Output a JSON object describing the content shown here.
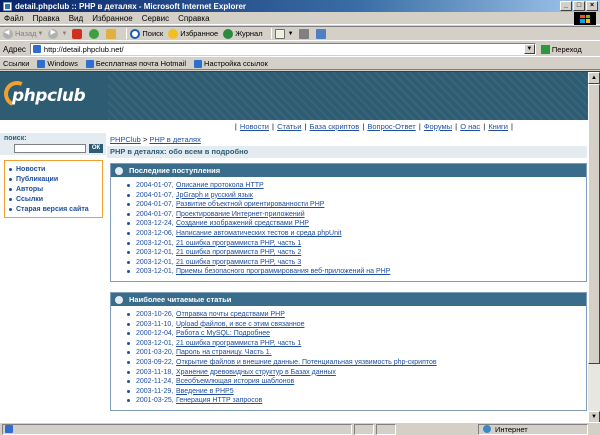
{
  "window": {
    "title": "detail.phpclub :: PHP в деталях - Microsoft Internet Explorer",
    "controls": {
      "minimize": "_",
      "maximize": "□",
      "close": "×"
    }
  },
  "menu": [
    "Файл",
    "Правка",
    "Вид",
    "Избранное",
    "Сервис",
    "Справка"
  ],
  "toolbar": {
    "back": "Назад",
    "search": "Поиск",
    "favorites": "Избранное",
    "history": "Журнал"
  },
  "address": {
    "label": "Адрес",
    "url": "http://detail.phpclub.net/",
    "go": "Переход"
  },
  "links": {
    "label": "Ссылки",
    "items": [
      "Windows",
      "Бесплатная почта Hotmail",
      "Настройка ссылок"
    ]
  },
  "site": {
    "logo": "phpclub",
    "nav": [
      "Новости",
      "Статьи",
      "База скриптов",
      "Вопрос-Ответ",
      "Форумы",
      "О нас",
      "Книги"
    ],
    "search": {
      "label": "поиск:",
      "button": "ОК"
    },
    "leftnav": [
      "Новости",
      "Публикации",
      "Авторы",
      "Ссылки",
      "Старая версия сайта"
    ],
    "breadcrumb": {
      "home": "PHPClub",
      "sep": " > ",
      "current": "PHP в деталях"
    },
    "subtitle": "PHP в деталях: обо всем в подробно",
    "recent": {
      "title": "Последние поступления",
      "items": [
        {
          "date": "2004-01-07,",
          "title": "Описание протокола HTTP"
        },
        {
          "date": "2004-01-07,",
          "title": "JpGraph и русский язык"
        },
        {
          "date": "2004-01-07,",
          "title": "Развитие объектной ориентированности PHP"
        },
        {
          "date": "2004-01-07,",
          "title": "Проектирование Интернет-приложений"
        },
        {
          "date": "2003-12-24,",
          "title": "Создание изображений средствами PHP"
        },
        {
          "date": "2003-12-06,",
          "title": "Написание автоматических тестов и среда phpUnit"
        },
        {
          "date": "2003-12-01,",
          "title": "21 ошибка программиста PHP, часть 1"
        },
        {
          "date": "2003-12-01,",
          "title": "21 ошибка программиста PHP, часть 2"
        },
        {
          "date": "2003-12-01,",
          "title": "21 ошибка программиста PHP, часть 3"
        },
        {
          "date": "2003-12-01,",
          "title": "Приемы безопасного программирования веб-приложений на PHP"
        }
      ]
    },
    "popular": {
      "title": "Наиболее читаемые статьи",
      "items": [
        {
          "date": "2003-10-26,",
          "title": "Отправка почты средствами PHP"
        },
        {
          "date": "2003-11-10,",
          "title": "Upload файлов, и все с этим связанное"
        },
        {
          "date": "2000-12-04,",
          "title": "Работа с MySQL: Подробнее"
        },
        {
          "date": "2003-12-01,",
          "title": "21 ошибка программиста PHP, часть 1"
        },
        {
          "date": "2001-03-20,",
          "title": "Пароль на страницу. Часть 1."
        },
        {
          "date": "2003-09-22,",
          "title": "Открытие файлов и внешние данные. Потенциальная уязвимость php-скриптов"
        },
        {
          "date": "2003-11-18,",
          "title": "Хранение древовидных структур в Базах данных"
        },
        {
          "date": "2002-11-24,",
          "title": "Всеобъемлющая история шаблонов"
        },
        {
          "date": "2003-11-29,",
          "title": "Введение в PHP5"
        },
        {
          "date": "2001-03-25,",
          "title": "Генерация HTTP запросов"
        }
      ]
    }
  },
  "status": {
    "zone": "Интернет"
  },
  "colors": {
    "header": "#2e5d73",
    "boxHead": "#3a6c8c",
    "link": "#1f4fa0",
    "accent": "#f0a030"
  }
}
